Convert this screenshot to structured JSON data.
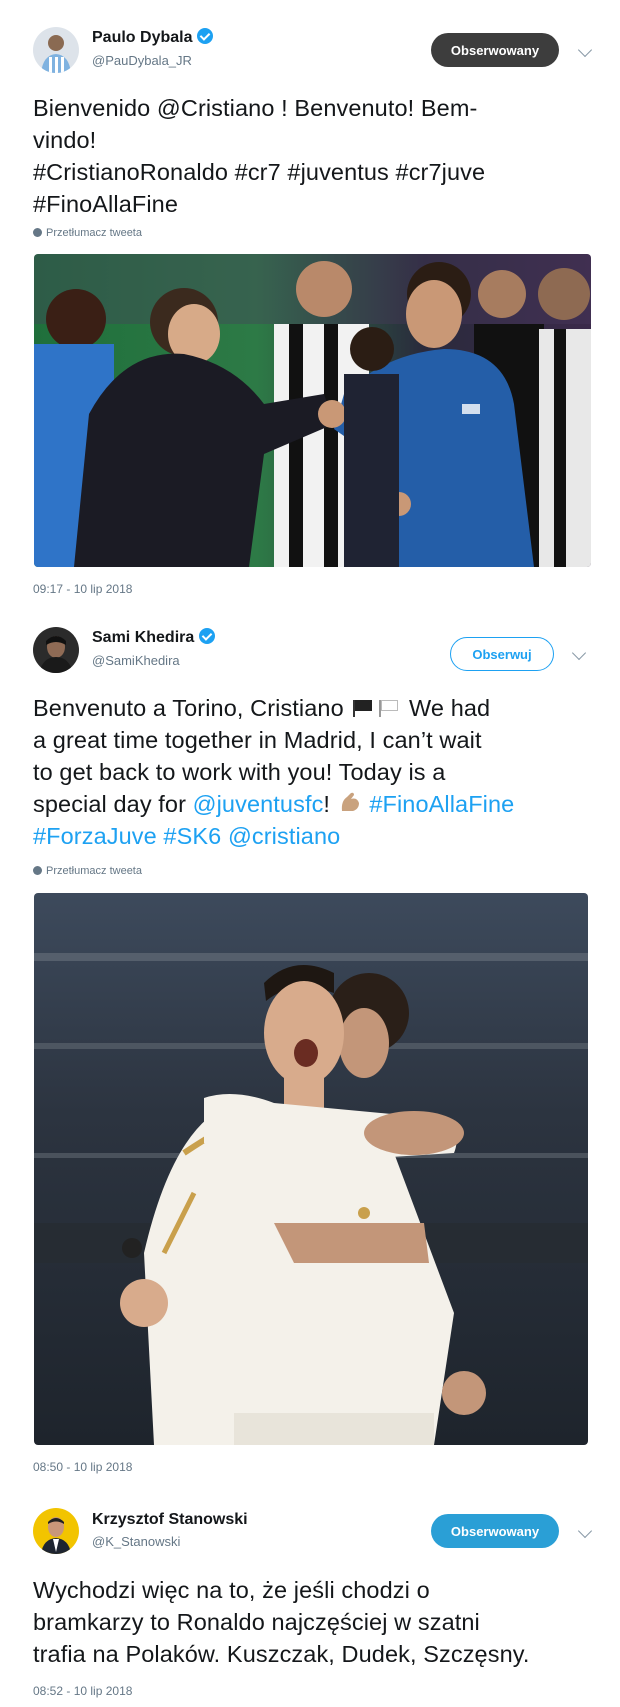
{
  "tweets": [
    {
      "name": "Paulo Dybala",
      "handle": "@PauDybala_JR",
      "follow_label": "Obserwowany",
      "text_parts": [
        "Bienvenido @Cristiano ! Benvenuto! Bem-",
        "vindo!",
        "#CristianoRonaldo #cr7 #juventus #cr7juve",
        "#FinoAllaFine"
      ],
      "translate_label": "Przetłumacz tweeta",
      "timestamp": "09:17 - 10 lip 2018"
    },
    {
      "name": "Sami Khedira",
      "handle": "@SamiKhedira",
      "follow_label": "Obserwuj",
      "line1": "Benvenuto a Torino, Cristiano",
      "line1_end": "We had",
      "line2": "a great time together in Madrid, I can’t wait",
      "line3": "to get back to work with you! Today is a",
      "line4_pre": "special day for ",
      "mention_juve": "@juventusfc",
      "line4_excl": "! ",
      "hashtag_fino": "#FinoAllaFine",
      "hashtag_forza": "#ForzaJuve",
      "hashtag_sk6": "#SK6",
      "mention_cristiano": "@cristiano",
      "translate_label": "Przetłumacz tweeta",
      "timestamp": "08:50 - 10 lip 2018"
    },
    {
      "name": "Krzysztof Stanowski",
      "handle": "@K_Stanowski",
      "follow_label": "Obserwowany",
      "text_lines": [
        "Wychodzi więc na to, że jeśli chodzi o",
        "bramkarzy to Ronaldo najczęściej w szatni",
        "trafia na Polaków. Kuszczak, Dudek, Szczęsny."
      ],
      "timestamp": "08:52 - 10 lip 2018"
    }
  ],
  "colors": {
    "link": "#1da1f2",
    "verified": "#1da1f2",
    "follow_blue": "#2a9fd6",
    "follow_dark": "#3d3d3d"
  }
}
